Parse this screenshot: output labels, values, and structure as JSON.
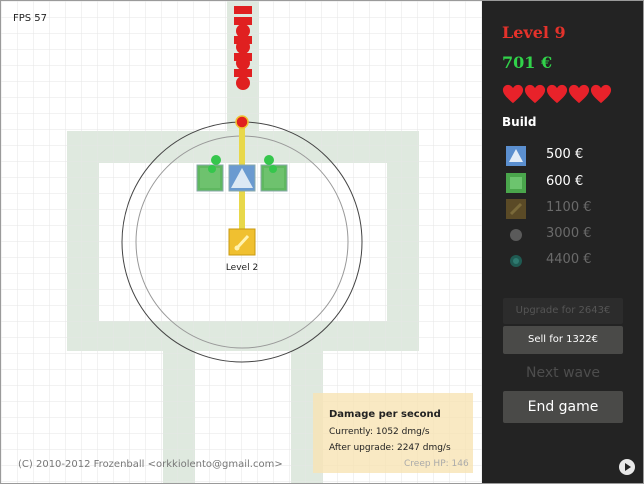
{
  "hud": {
    "fps": "FPS 57"
  },
  "game": {
    "selected_tower_label": "Level 2",
    "copyright": "(C) 2010-2012 Frozenball <orkkiolento@gmail.com>",
    "creep_hp": "Creep HP: 146"
  },
  "dps_box": {
    "title": "Damage per second",
    "current": "Currently: 1052 dmg/s",
    "after": "After upgrade: 2247 dmg/s"
  },
  "sidebar": {
    "level": "Level 9",
    "money": "701 €",
    "lives": 5,
    "build_title": "Build",
    "build_items": [
      {
        "price": "500 €",
        "icon": "blue-triangle-tower-icon",
        "available": true
      },
      {
        "price": "600 €",
        "icon": "green-square-tower-icon",
        "available": true
      },
      {
        "price": "1100 €",
        "icon": "brown-tower-icon",
        "available": false
      },
      {
        "price": "3000 €",
        "icon": "gray-circle-tower-icon",
        "available": false
      },
      {
        "price": "4400 €",
        "icon": "teal-circle-tower-icon",
        "available": false
      }
    ],
    "upgrade_button": "Upgrade for 2643€",
    "sell_button": "Sell for 1322€",
    "next_wave_button": "Next wave",
    "end_game_button": "End game",
    "play_icon": "play-icon"
  },
  "colors": {
    "level": "#e4322b",
    "money": "#31d34a",
    "heart": "#e8222a",
    "available_price": "#ffffff",
    "unavailable_price": "#6a6a6a",
    "path": "#dfe9df",
    "laser": "#e8d84a"
  }
}
